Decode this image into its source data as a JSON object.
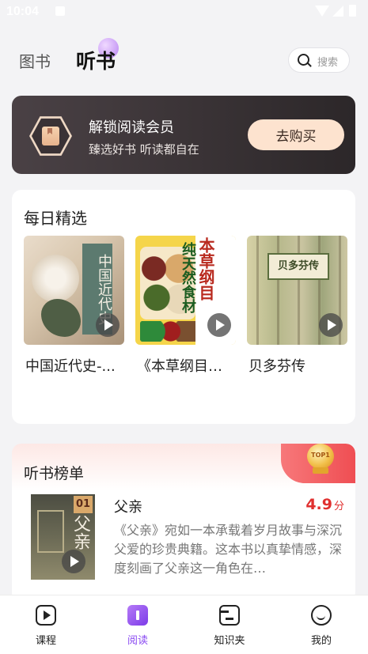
{
  "status_bar": {
    "time": "10:04"
  },
  "header": {
    "tabs": [
      {
        "label": "图书",
        "active": false
      },
      {
        "label": "听书",
        "active": true
      }
    ],
    "search_placeholder": "搜索"
  },
  "vip_banner": {
    "title": "解锁阅读会员",
    "subtitle": "臻选好书 听读都自在",
    "button_label": "去购买"
  },
  "daily": {
    "title": "每日精选",
    "books": [
      {
        "title": "中国近代史-...",
        "cover_text": "中国近代史"
      },
      {
        "title": "《本草纲目…",
        "cover_text_main": "本草纲目",
        "cover_text_side": "纯天然食材"
      },
      {
        "title": "贝多芬传",
        "cover_text": "贝多芬传"
      }
    ]
  },
  "ranking": {
    "title": "听书榜单",
    "badge_text": "TOP1",
    "items": [
      {
        "rank": "01",
        "name": "父亲",
        "cover_text": "父亲",
        "score": "4.9",
        "score_unit": "分",
        "description": "《父亲》宛如一本承载着岁月故事与深沉父爱的珍贵典籍。这本书以真挚情感，深度刻画了父亲这一角色在…"
      }
    ]
  },
  "bottom_nav": [
    {
      "label": "课程",
      "icon": "play-square-icon",
      "active": false
    },
    {
      "label": "阅读",
      "icon": "book-icon",
      "active": true
    },
    {
      "label": "知识夹",
      "icon": "folder-icon",
      "active": false
    },
    {
      "label": "我的",
      "icon": "smile-icon",
      "active": false
    }
  ],
  "colors": {
    "accent": "#8b4bf2",
    "score": "#e0302f",
    "vip_button": "#fde3cf",
    "vip_bg": "#3a3235"
  }
}
